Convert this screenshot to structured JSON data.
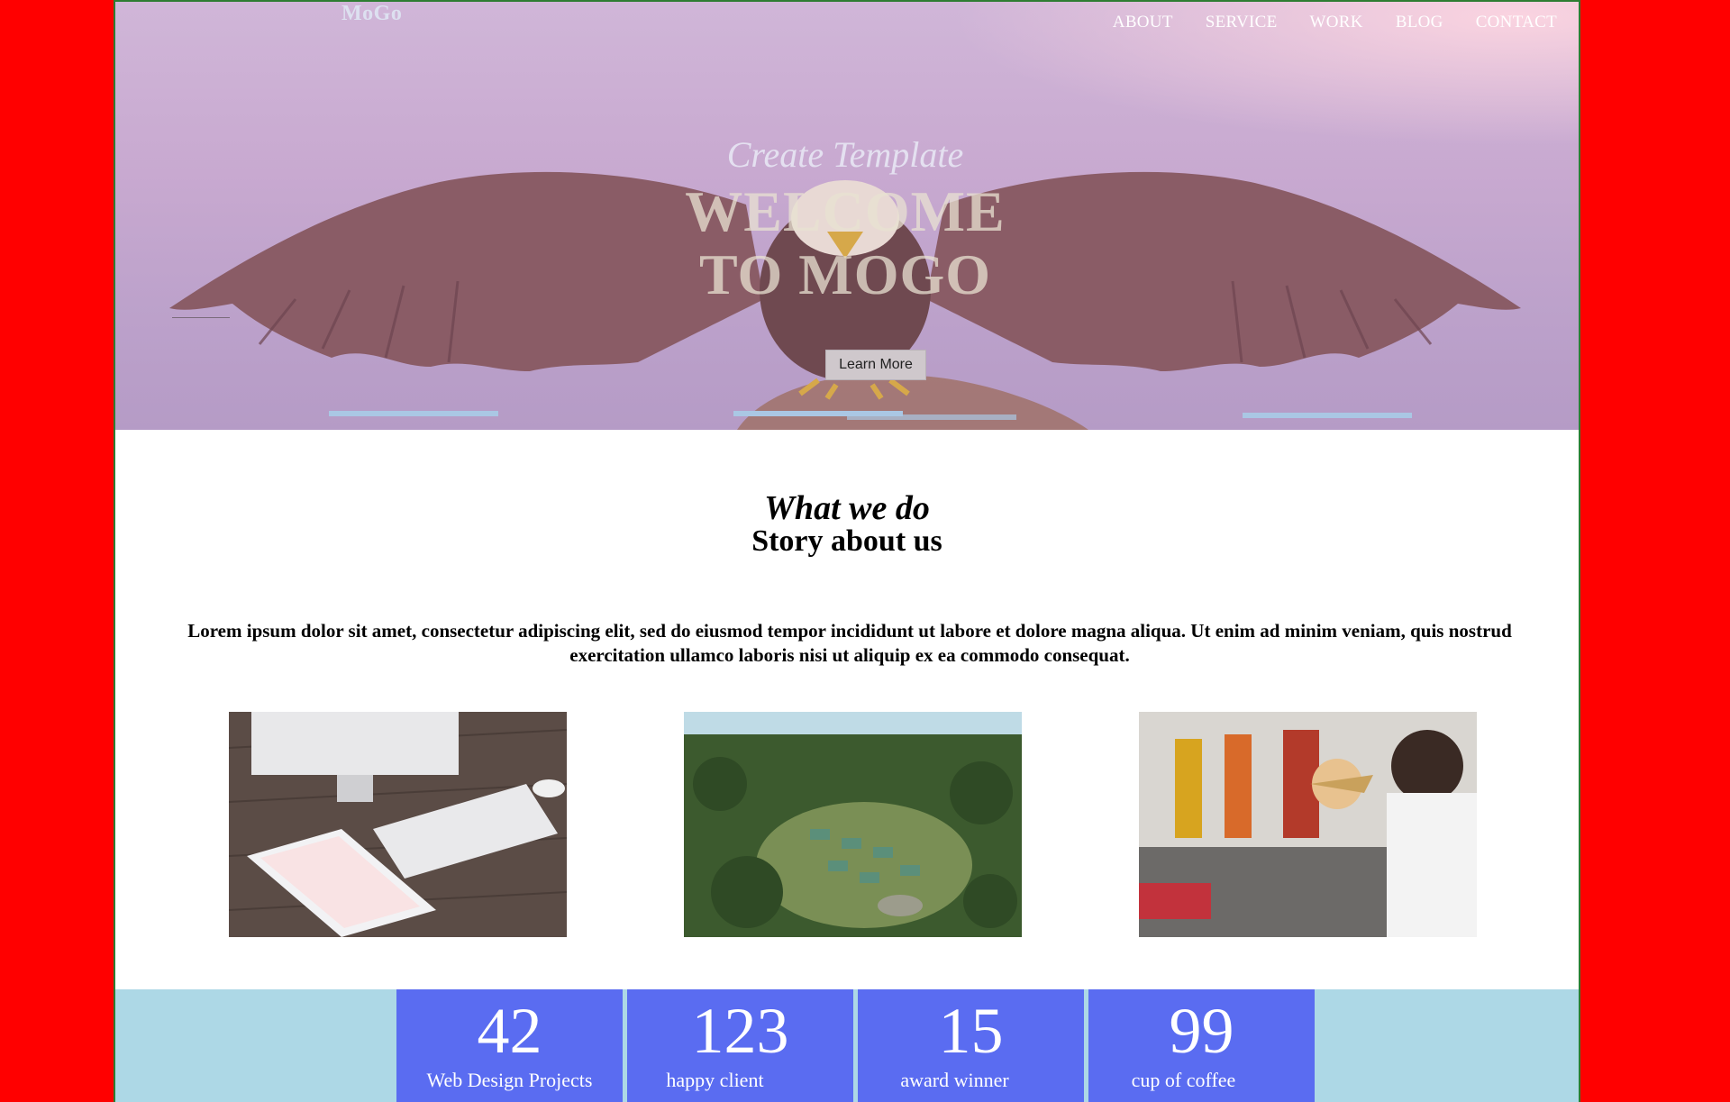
{
  "header": {
    "logo": "MoGo",
    "nav": [
      "ABOUT",
      "SERVICE",
      "WORK",
      "BLOG",
      "CONTACT"
    ]
  },
  "hero": {
    "subtitle": "Create Template",
    "title_line1": "WELCOME",
    "title_line2": "TO MOGO",
    "button_label": "Learn More"
  },
  "about": {
    "subtitle": "What we do",
    "title": "Story about us",
    "text": "Lorem ipsum dolor sit amet, consectetur adipiscing elit, sed do eiusmod tempor incididunt ut labore et dolore magna aliqua. Ut enim ad minim veniam, quis nostrud exercitation ullamco laboris nisi ut aliquip ex ea commodo consequat.",
    "photos": [
      "desk-workspace-photo",
      "forest-village-photo",
      "office-meeting-photo"
    ]
  },
  "stats": [
    {
      "number": "42",
      "label": "Web Design Projects"
    },
    {
      "number": "123",
      "label": "happy client"
    },
    {
      "number": "15",
      "label": "award winner"
    },
    {
      "number": "99",
      "label": "cup of coffee"
    }
  ],
  "colors": {
    "page_bg": "#ff0000",
    "stats_bg": "#add8e6",
    "stat_box": "#5a6cf1",
    "frame_border": "#2e7d32"
  }
}
